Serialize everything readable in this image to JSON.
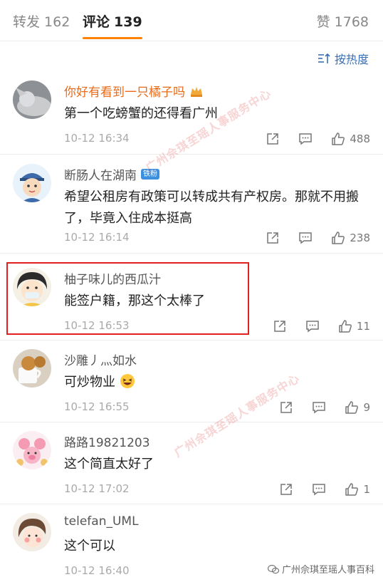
{
  "tabs": {
    "repost": {
      "label": "转发",
      "count": "162"
    },
    "comments": {
      "label": "评论",
      "count": "139"
    },
    "likes": {
      "label": "赞",
      "count": "1768"
    }
  },
  "sort": {
    "label": "按热度"
  },
  "comments": [
    {
      "user": "你好有看到一只橘子吗",
      "badge": "",
      "text": "第一个吃螃蟹的还得看广州",
      "time": "10-12 16:34",
      "likes": "488"
    },
    {
      "user": "断肠人在湖南",
      "badge": "铁粉",
      "text": "希望公租房有政策可以转成共有产权房。那就不用搬了，毕竟入住成本挺高",
      "time": "10-12 16:14",
      "likes": "238"
    },
    {
      "user": "柚子味儿的西瓜汁",
      "badge": "",
      "text": "能签户籍，那这个太棒了",
      "time": "10-12 16:53",
      "likes": "11"
    },
    {
      "user": "沙雕丿灬如水",
      "badge": "",
      "text": "可炒物业",
      "time": "10-12 16:55",
      "likes": "9"
    },
    {
      "user": "路路19821203",
      "badge": "",
      "text": "这个简直太好了",
      "time": "10-12 17:02",
      "likes": "1"
    },
    {
      "user": "telefan_UML",
      "badge": "",
      "text": "这个可以",
      "time": "10-12 16:40",
      "likes": ""
    }
  ],
  "watermark": {
    "text": "广州佘琪至瑶人事服务中心"
  },
  "footer": {
    "text": "广州佘琪至瑶人事百科"
  },
  "colors": {
    "accent": "#ff8200",
    "highlight": "#e32020",
    "link": "#3a6fb5"
  }
}
